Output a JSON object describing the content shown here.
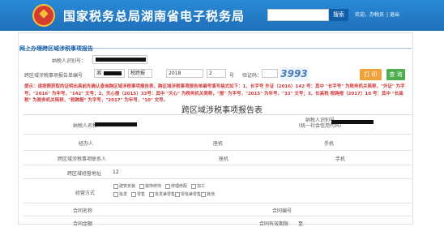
{
  "header": {
    "title": "国家税务总局湖南省电子税务局",
    "search_button": "搜索",
    "links": [
      "欢迎，办税员",
      "退出"
    ]
  },
  "breadcrumb": "网上办理跨区域涉税事项报告",
  "form": {
    "taxpayer_id_label": "纳税人识别号：",
    "report_no_label": "跨区域涉税事项报告单编号",
    "report_no_prefix": "湘",
    "dept_value": "税跨报",
    "year_value": "2018",
    "number_value": "2",
    "number_suffix": "号",
    "captcha_label": "验证码：",
    "captcha_value": "3993",
    "print_button": "打 印",
    "query_button": "查 询"
  },
  "notice": "提示：请按照获取的证明出具前先确认查询跨区域涉税事项报告表，跨区域涉税事项报告单编号填写格式如下：1、长字号 外证（2016）142 号：其中 \"长字号\" 为税务机关简称，\"外证\" 为字号，\"2016\" 为年号，\"142\" 文号；2、天心报（2015）33号：其中 \"天心\" 为税务机关简称，\"报\" 为字号，\"2015\" 为年号，\"33\" 文号；3、长高税 税跨报（2017）10 号：其中 \"长高税\" 为税务机关简称，\"税跨报\" 为字号，\"2017\" 为年号，\"10\" 文号。",
  "report": {
    "title": "跨区域涉税事项报告表",
    "taxpayer_name_label": "纳税人名称",
    "credit_code_label": "纳税人识别号\n（统一社会信用代码）",
    "handler_label": "经办人",
    "id_label": "身份证件号码",
    "seat_label": "座机",
    "mobile_label": "手机",
    "contact_label": "跨区域涉税事项联系人",
    "address_label": "跨区域经营地址",
    "address_value": "12",
    "business_label": "经营方式",
    "business_options": [
      "建筑安装",
      "装饰修饰",
      "修理修配",
      "加工",
      "批发",
      "零售",
      "批发兼零售",
      "零批兼零售",
      "其他"
    ],
    "contract_name_label": "合同名称",
    "contract_no_label": "合同编号",
    "contract_amount_label": "合同金额",
    "contract_period_label": "合同有效期限",
    "contract_period_value": "至"
  }
}
